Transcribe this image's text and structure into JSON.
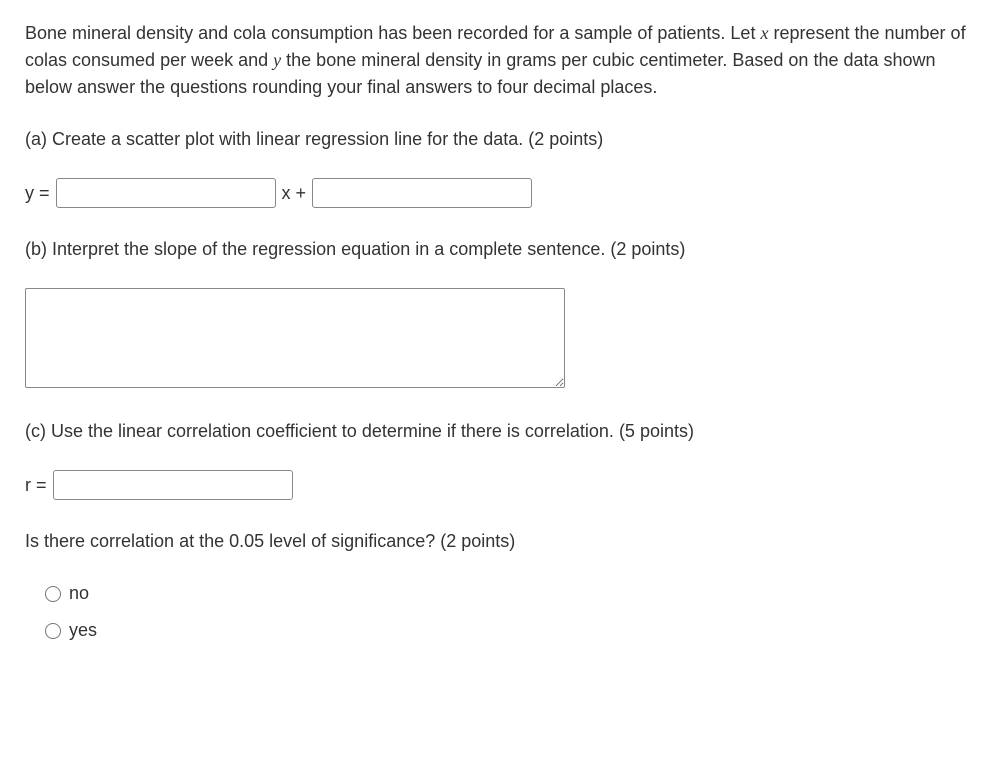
{
  "intro": {
    "text_before_x": "Bone mineral density and cola consumption has been recorded for a sample of patients. Let ",
    "var_x": "x",
    "text_mid": " represent the number of colas consumed per week and ",
    "var_y": "y",
    "text_after_y": " the bone mineral density in grams per cubic centimeter. Based on the data shown below answer the questions rounding your final answers to four decimal places."
  },
  "part_a": {
    "prompt": "(a) Create a scatter plot with linear regression line for the data. (2 points)",
    "y_equals": "y =",
    "x_plus": "x +"
  },
  "part_b": {
    "prompt": "(b) Interpret the slope of the regression equation in a complete sentence. (2 points)"
  },
  "part_c": {
    "prompt": "(c) Use the linear correlation coefficient to determine if there is correlation. (5 points)",
    "r_equals": "r ="
  },
  "correlation_question": {
    "prompt": "Is there correlation at the 0.05 level of significance? (2 points)",
    "option_no": "no",
    "option_yes": "yes"
  }
}
